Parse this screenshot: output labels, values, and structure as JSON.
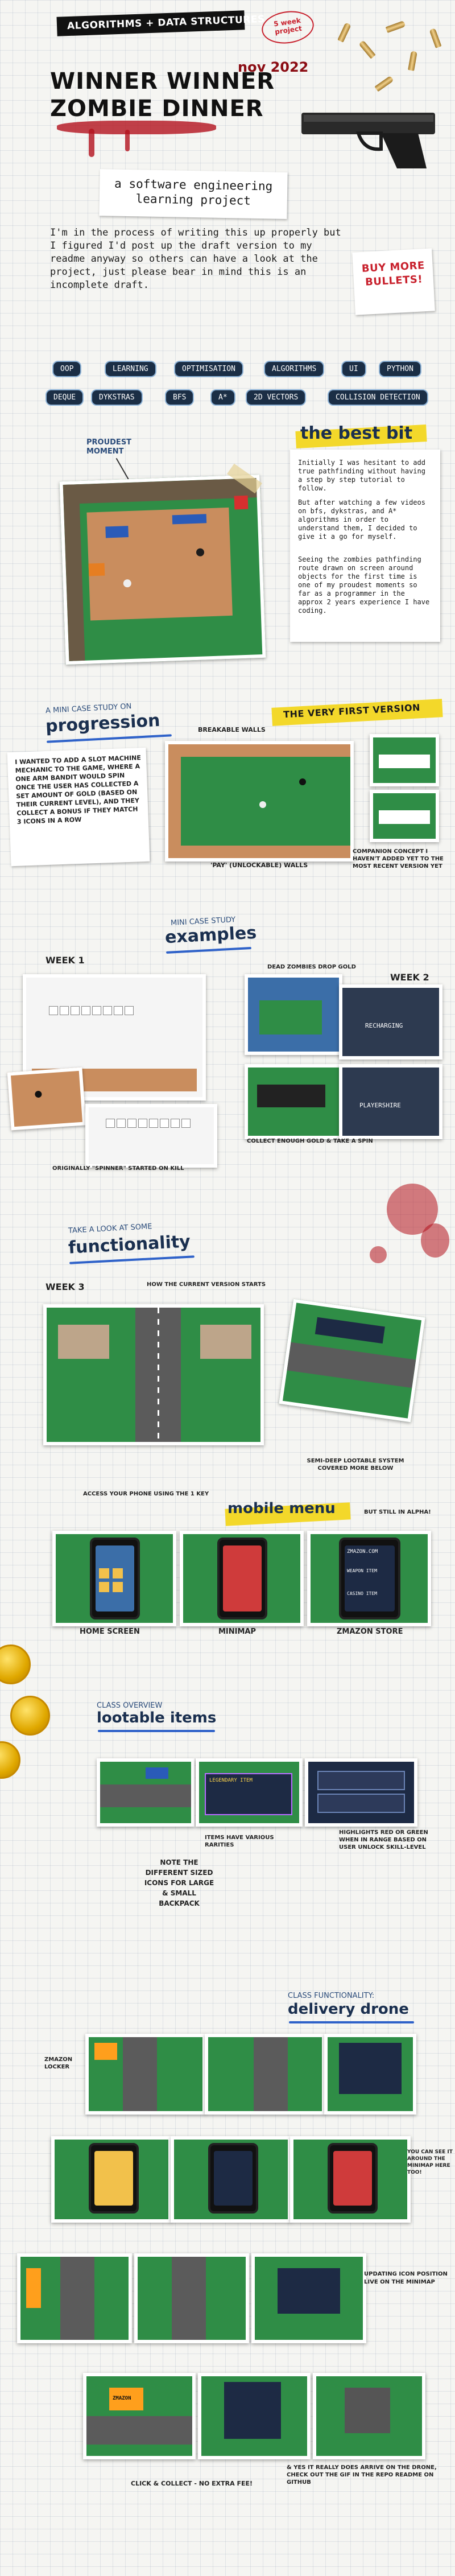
{
  "header": {
    "topic_banner": "ALGORITHMS + DATA STRUCTURES",
    "badge": "5 week project",
    "title_line1": "WINNER WINNER",
    "title_line2": "ZOMBIE DINNER",
    "date": "nov 2022",
    "subtitle": "a software engineering learning project",
    "intro": "I'm in the process of writing this up properly but I figured I'd post up the draft version to my readme anyway so others can have a look at the project, just please bear in mind this is an incomplete draft.",
    "buy_note": "BUY MORE BULLETS!"
  },
  "tags": [
    "OOP",
    "LEARNING",
    "OPTIMISATION",
    "ALGORITHMS",
    "UI",
    "PYTHON",
    "DEQUE",
    "DYKSTRAS",
    "BFS",
    "A*",
    "2D VECTORS",
    "COLLISION DETECTION"
  ],
  "best_bit": {
    "moment_label": "PROUDEST MOMENT",
    "heading": "the best bit",
    "text1": "Initially I was hesitant to add true pathfinding without having a step by step tutorial to follow.",
    "text2": "But after watching a few videos on bfs, dykstras, and A* algorithms in order to understand them, I decided to give it a go for myself.",
    "text3": "Seeing the zombies pathfinding route drawn on screen around objects for the first time is one of my proudest moments so far as a programmer in the approx 2 years experience I have coding."
  },
  "progression": {
    "small": "A MINI CASE STUDY ON",
    "heading": "progression",
    "first_version": "THE VERY FIRST VERSION",
    "breakable_walls": "BREAKABLE WALLS",
    "pay_walls": "'PAY' (UNLOCKABLE) WALLS",
    "companion": "COMPANION CONCEPT I HAVEN'T ADDED YET TO THE MOST RECENT VERSION YET",
    "note": "I WANTED TO ADD A SLOT MACHINE MECHANIC TO THE GAME, WHERE A ONE ARM BANDIT WOULD SPIN ONCE THE USER HAS COLLECTED A SET AMOUNT OF GOLD (BASED ON THEIR CURRENT LEVEL), AND THEY COLLECT A BONUS IF THEY MATCH 3 ICONS IN A ROW"
  },
  "examples": {
    "small": "MINI CASE STUDY",
    "heading": "examples",
    "week1": "week 1",
    "week2": "week 2",
    "dead_zombies": "DEAD ZOMBIES DROP GOLD",
    "spinner": "ORIGINALLY \"SPINNER\" STARTED ON KILL",
    "collect": "COLLECT ENOUGH GOLD & TAKE A SPIN",
    "ingame_text": "RECHARGING",
    "reel_text": "PLAYERSHIRE"
  },
  "functionality": {
    "small": "TAKE A LOOK AT SOME",
    "heading": "functionality",
    "week3": "week 3",
    "current": "HOW THE CURRENT VERSION STARTS",
    "semi_deep": "SEMI-DEEP LOOTABLE SYSTEM COVERED MORE BELOW"
  },
  "mobile": {
    "access": "ACCESS YOUR PHONE USING THE 1 KEY",
    "heading": "mobile menu",
    "still_alpha": "BUT STILL IN ALPHA!",
    "home": "HOME SCREEN",
    "minimap": "MINIMAP",
    "store": "ZMAZON STORE",
    "store_title": "ZMAZON.COM",
    "item1": "WEAPON ITEM",
    "item2": "CASINO ITEM"
  },
  "lootable": {
    "small": "CLASS OVERVIEW",
    "heading": "lootable items",
    "items_label": "ITEMS HAVE VARIOUS RARITIES",
    "highlights": "HIGHLIGHTS RED OR GREEN WHEN IN RANGE BASED ON USER UNLOCK SKILL-LEVEL",
    "note_sizes": "NOTE THE DIFFERENT SIZED ICONS FOR LARGE & SMALL BACKPACK",
    "tip_title": "LEGENDARY ITEM"
  },
  "delivery": {
    "small": "CLASS FUNCTIONALITY:",
    "heading": "delivery drone",
    "locker": "ZMAZON LOCKER",
    "around": "YOU CAN SEE IT AROUND THE MINIMAP HERE TOO!",
    "updating": "UPDATING ICON POSITION LIVE ON THE MINIMAP",
    "collect": "CLICK & COLLECT - NO EXTRA FEE!",
    "footer": "& YES IT REALLY DOES ARRIVE ON THE DRONE, CHECK OUT THE GIF IN THE REPO README ON GITHUB",
    "locker_sign": "ZMAZON"
  }
}
